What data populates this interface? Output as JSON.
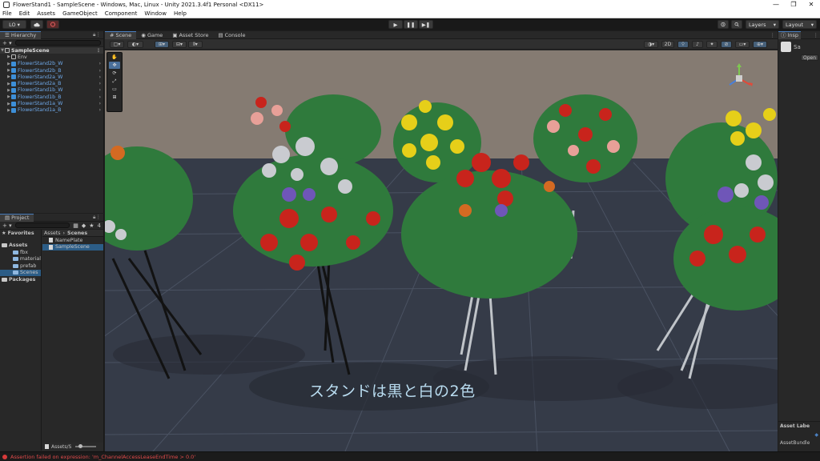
{
  "window": {
    "title": "FlowerStand1 - SampleScene - Windows, Mac, Linux - Unity 2021.3.4f1 Personal <DX11>",
    "controls": [
      "—",
      "❐",
      "✕"
    ]
  },
  "menu": [
    "File",
    "Edit",
    "Assets",
    "GameObject",
    "Component",
    "Window",
    "Help"
  ],
  "toolbar": {
    "account": "LO ▾",
    "cloud_icon": "cloud-icon",
    "collab_icon": "collab-icon",
    "play": "▶",
    "pause": "❚❚",
    "step": "▶❚",
    "history_icon": "history-icon",
    "search_icon": "search-icon",
    "layers": "Layers",
    "layout": "Layout"
  },
  "hierarchy": {
    "tab": "Hierarchy",
    "add": "+ ▾",
    "search_prefix": "All",
    "scene": "SampleScene",
    "items": [
      {
        "label": "Env",
        "kind": "grey"
      },
      {
        "label": "FlowerStand2b_W",
        "kind": "blue"
      },
      {
        "label": "FlowerStand2b_B",
        "kind": "blue"
      },
      {
        "label": "FlowerStand2a_W",
        "kind": "blue"
      },
      {
        "label": "FlowerStand2a_B",
        "kind": "blue"
      },
      {
        "label": "FlowerStand1b_W",
        "kind": "blue"
      },
      {
        "label": "FlowerStand1b_B",
        "kind": "blue"
      },
      {
        "label": "FlowerStand1a_W",
        "kind": "blue"
      },
      {
        "label": "FlowerStand1a_B",
        "kind": "blue"
      }
    ]
  },
  "project": {
    "tab": "Project",
    "add": "+ ▾",
    "favorites": "Favorites",
    "assets": "Assets",
    "folders": [
      "fbx",
      "material",
      "prefab",
      "Scenes"
    ],
    "packages": "Packages",
    "breadcrumb": [
      "Assets",
      "›",
      "Scenes"
    ],
    "files": [
      "NamePlate",
      "SampleScene"
    ],
    "bottom_path": "Assets/S",
    "hidden_count": "4"
  },
  "scene_view": {
    "tabs": [
      "Scene",
      "Game",
      "Asset Store",
      "Console"
    ],
    "mode_2d": "2D",
    "tools": [
      "✋",
      "✥",
      "⟳",
      "⤢",
      "▭",
      "⊞"
    ],
    "subtitle": "スタンドは黒と白の2色"
  },
  "inspector": {
    "tab": "Insp",
    "asset_name": "Sa",
    "open_button": "Open",
    "asset_labels": "Asset Labe",
    "asset_bundle": "AssetBundle"
  },
  "status": {
    "message": "Assertion failed on expression: 'm_ChannelAccessLeaseEndTime > 0.0'"
  },
  "colors": {
    "accent": "#4a7fc0",
    "selection": "#2c5d87",
    "error": "#e04a4a",
    "subtitle": "#b9dcf0"
  }
}
